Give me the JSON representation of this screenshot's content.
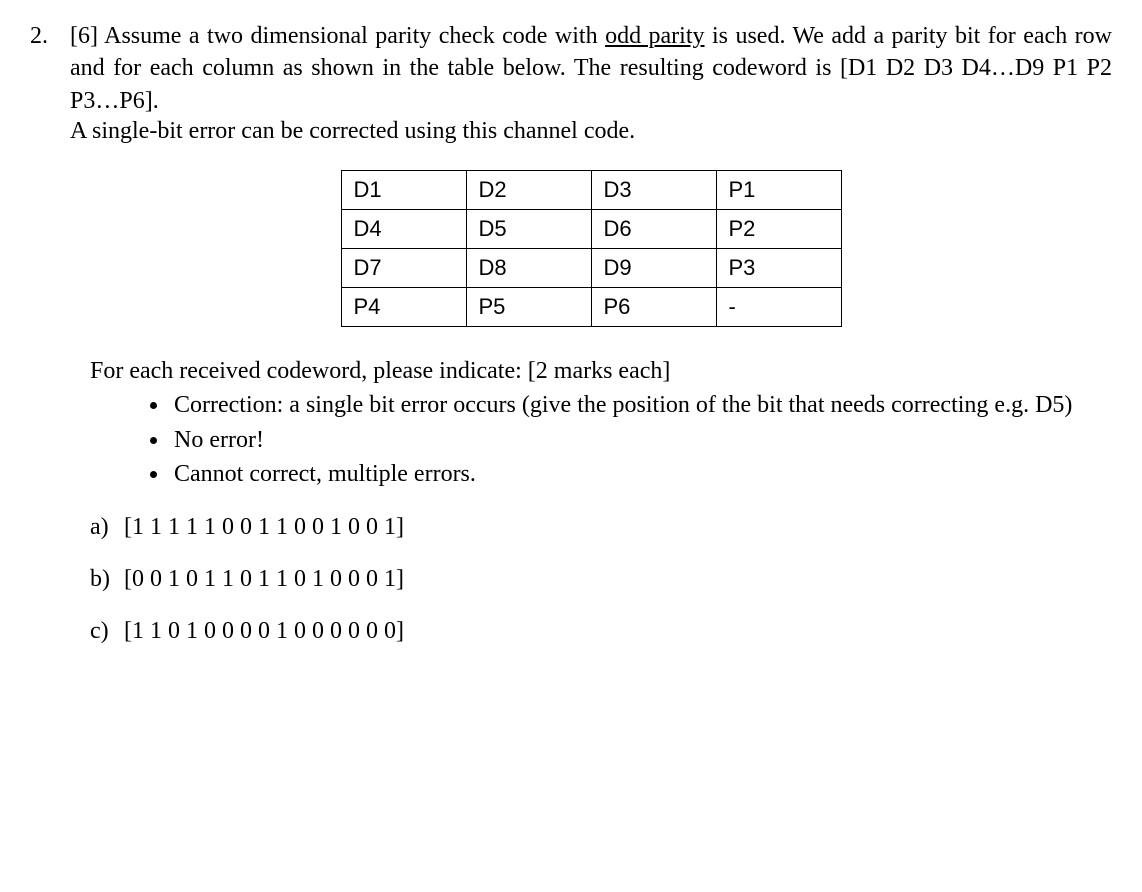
{
  "question": {
    "number": "2.",
    "points_tag": "[6]",
    "intro_part1": " Assume a two dimensional parity check code with ",
    "underlined": "odd parity",
    "intro_part2": " is used. We add a parity bit for each row and for each column as shown in the table below. The resulting codeword is [D1 D2 D3 D4…D9 P1 P2 P3…P6].",
    "intro_line2": "A single-bit error can be corrected using this channel code."
  },
  "table": {
    "rows": [
      [
        "D1",
        "D2",
        "D3",
        "P1"
      ],
      [
        "D4",
        "D5",
        "D6",
        "P2"
      ],
      [
        "D7",
        "D8",
        "D9",
        "P3"
      ],
      [
        "P4",
        "P5",
        "P6",
        "-"
      ]
    ]
  },
  "instructions": {
    "lead": "For each received codeword, please indicate: [2 marks each]",
    "bullets": [
      "Correction: a single bit error occurs (give the position of the bit that needs correcting e.g. D5)",
      "No error!",
      "Cannot correct, multiple errors."
    ]
  },
  "parts": {
    "a": {
      "label": "a)",
      "codeword": "[1 1 1 1 1 0 0 1 1 0 0 1 0 0 1]"
    },
    "b": {
      "label": "b)",
      "codeword": "[0 0 1 0 1 1 0 1 1 0 1 0 0 0 1]"
    },
    "c": {
      "label": "c)",
      "codeword": "[1 1 0 1 0 0 0 0 1 0 0 0 0 0 0]"
    }
  }
}
